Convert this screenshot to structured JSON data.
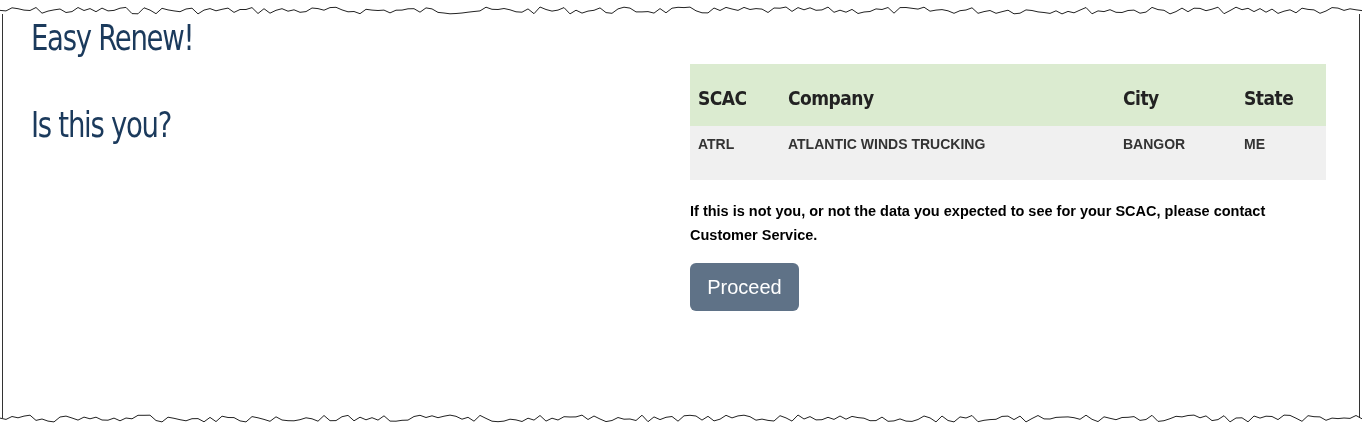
{
  "title": "Easy Renew!",
  "question": "Is this you?",
  "table": {
    "columns": [
      "SCAC",
      "Company",
      "City",
      "State"
    ],
    "rows": [
      [
        "ATRL",
        "ATLANTIC WINDS TRUCKING",
        "BANGOR",
        "ME"
      ]
    ]
  },
  "notice": "If this is not you, or not the data you expected to see for your SCAC, please contact Customer Service.",
  "buttons": [
    "Proceed"
  ]
}
